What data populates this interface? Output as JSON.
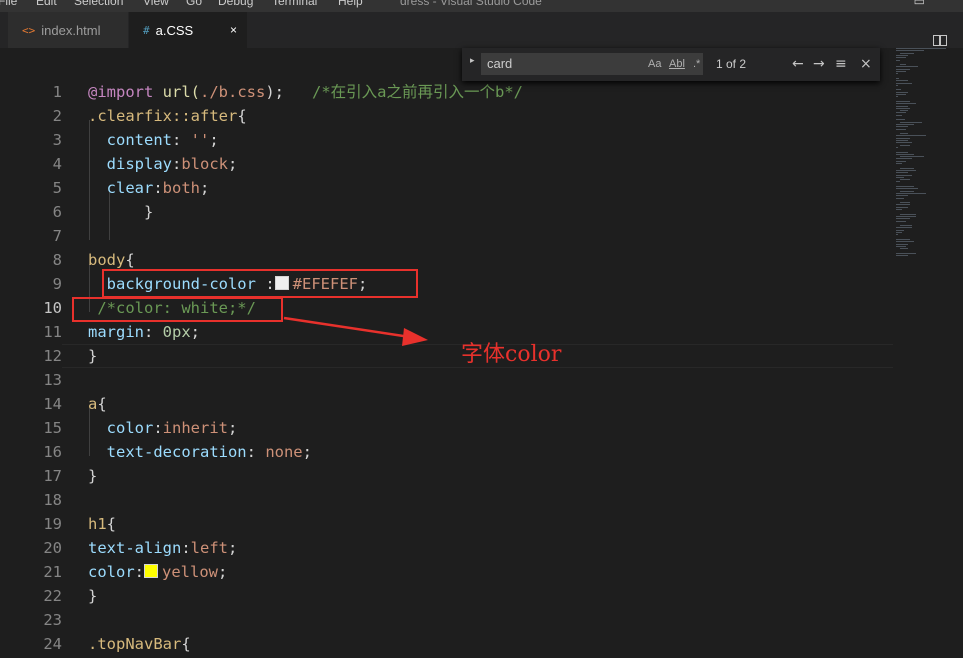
{
  "menubar": {
    "items": [
      "File",
      "Edit",
      "Selection",
      "View",
      "Go",
      "Debug",
      "Terminal",
      "Help"
    ],
    "title": "dress - Visual Studio Code"
  },
  "tabs": [
    {
      "label": "index.html",
      "icon": "html-file-icon"
    },
    {
      "label": "a.CSS",
      "icon": "css-file-icon",
      "close": "×"
    }
  ],
  "find": {
    "toggle": "▸",
    "value": "card",
    "match_case": "Aa",
    "whole_word": "Abl",
    "regex": ".*",
    "count": "1 of 2",
    "prev": "←",
    "next": "→",
    "close": "×"
  },
  "editor": {
    "active_line": 10,
    "line_numbers": [
      "1",
      "2",
      "3",
      "4",
      "5",
      "6",
      "7",
      "8",
      "9",
      "10",
      "11",
      "12",
      "13",
      "14",
      "15",
      "16",
      "17",
      "18",
      "19",
      "20",
      "21",
      "22",
      "23",
      "24"
    ],
    "lines": [
      [
        {
          "t": "@import",
          "c": "kw"
        },
        {
          "t": " url(",
          "c": "fn"
        },
        {
          "t": "./b.css",
          "c": "val"
        },
        {
          "t": ");",
          "c": "punc"
        },
        {
          "t": "   /*在引入a之前再引入一个b*/",
          "c": "com"
        }
      ],
      [
        {
          "t": ".clearfix::after",
          "c": "sel"
        },
        {
          "t": "{",
          "c": "punc"
        }
      ],
      [
        {
          "t": "  content",
          "c": "prop"
        },
        {
          "t": ": ",
          "c": "punc"
        },
        {
          "t": "''",
          "c": "val"
        },
        {
          "t": ";",
          "c": "punc"
        }
      ],
      [
        {
          "t": "  display",
          "c": "prop"
        },
        {
          "t": ":",
          "c": "punc"
        },
        {
          "t": "block",
          "c": "val"
        },
        {
          "t": ";",
          "c": "punc"
        }
      ],
      [
        {
          "t": "  clear",
          "c": "prop"
        },
        {
          "t": ":",
          "c": "punc"
        },
        {
          "t": "both",
          "c": "val"
        },
        {
          "t": ";",
          "c": "punc"
        }
      ],
      [
        {
          "t": "      }",
          "c": "punc"
        }
      ],
      [],
      [
        {
          "t": "body",
          "c": "sel"
        },
        {
          "t": "{",
          "c": "punc"
        }
      ],
      [
        {
          "t": "  background-color",
          "c": "prop"
        },
        {
          "t": " :",
          "c": "punc"
        },
        {
          "t": "",
          "c": "swatch",
          "color": "#EFEFEF"
        },
        {
          "t": "#EFEFEF",
          "c": "val"
        },
        {
          "t": ";",
          "c": "punc"
        }
      ],
      [
        {
          "t": " /*color: white;*/",
          "c": "com"
        }
      ],
      [
        {
          "t": "margin",
          "c": "prop"
        },
        {
          "t": ": ",
          "c": "punc"
        },
        {
          "t": "0px",
          "c": "num"
        },
        {
          "t": ";",
          "c": "punc"
        }
      ],
      [
        {
          "t": "}",
          "c": "punc"
        }
      ],
      [],
      [
        {
          "t": "a",
          "c": "sel"
        },
        {
          "t": "{",
          "c": "punc"
        }
      ],
      [
        {
          "t": "  color",
          "c": "prop"
        },
        {
          "t": ":",
          "c": "punc"
        },
        {
          "t": "inherit",
          "c": "val"
        },
        {
          "t": ";",
          "c": "punc"
        }
      ],
      [
        {
          "t": "  text-decoration",
          "c": "prop"
        },
        {
          "t": ": ",
          "c": "punc"
        },
        {
          "t": "none",
          "c": "val"
        },
        {
          "t": ";",
          "c": "punc"
        }
      ],
      [
        {
          "t": "}",
          "c": "punc"
        }
      ],
      [],
      [
        {
          "t": "h1",
          "c": "sel"
        },
        {
          "t": "{",
          "c": "punc"
        }
      ],
      [
        {
          "t": "text-align",
          "c": "prop"
        },
        {
          "t": ":",
          "c": "punc"
        },
        {
          "t": "left",
          "c": "val"
        },
        {
          "t": ";",
          "c": "punc"
        }
      ],
      [
        {
          "t": "color",
          "c": "prop"
        },
        {
          "t": ":",
          "c": "punc"
        },
        {
          "t": "",
          "c": "swatch",
          "color": "#FFFF00"
        },
        {
          "t": "yellow",
          "c": "val"
        },
        {
          "t": ";",
          "c": "punc"
        }
      ],
      [
        {
          "t": "}",
          "c": "punc"
        }
      ],
      [],
      [
        {
          "t": ".topNavBar",
          "c": "sel"
        },
        {
          "t": "{",
          "c": "punc"
        }
      ]
    ]
  },
  "annotation": {
    "text": "字体color",
    "color": "#e8312c"
  },
  "colors": {
    "editor_bg": "#1e1e1e",
    "annotation_red": "#e8312c"
  }
}
